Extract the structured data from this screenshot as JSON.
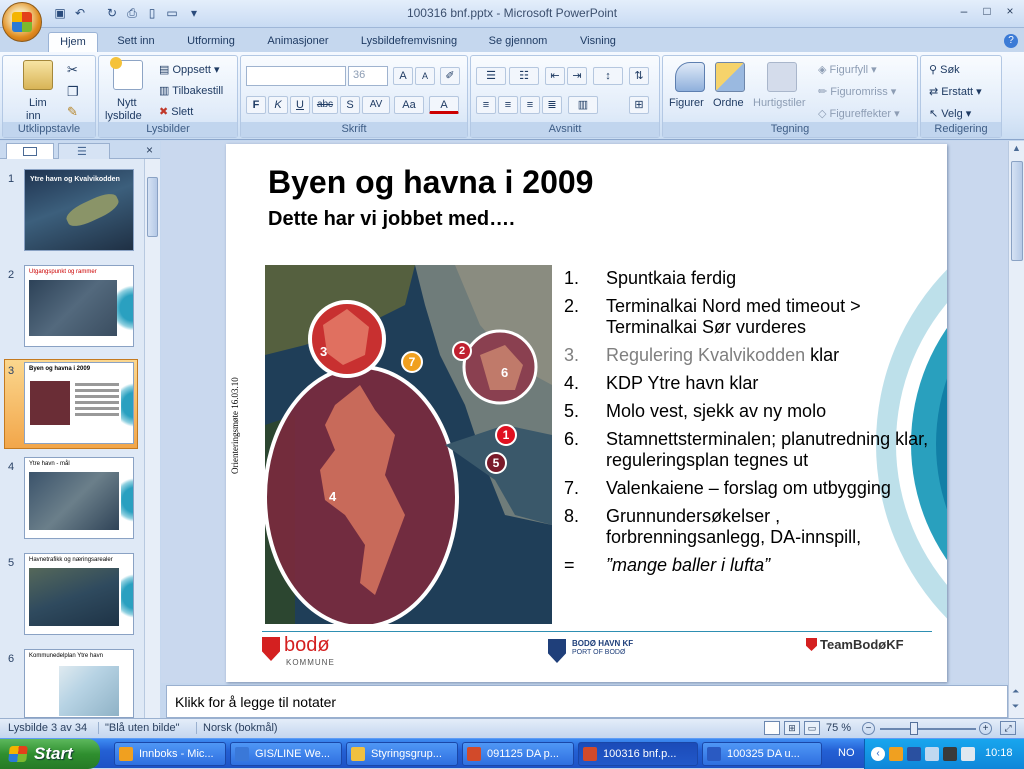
{
  "window": {
    "title": "100316 bnf.pptx - Microsoft PowerPoint",
    "controls": [
      "–",
      "□",
      "×"
    ]
  },
  "ribbon": {
    "tabs": [
      "Hjem",
      "Sett inn",
      "Utforming",
      "Animasjoner",
      "Lysbildefremvisning",
      "Se gjennom",
      "Visning"
    ],
    "groups": {
      "clipboard": {
        "label": "Utklippstavle",
        "paste_label_1": "Lim",
        "paste_label_2": "inn"
      },
      "slides": {
        "label": "Lysbilder",
        "new_1": "Nytt",
        "new_2": "lysbilde",
        "layout": "Oppsett",
        "reset": "Tilbakestill",
        "delete": "Slett"
      },
      "font": {
        "label": "Skrift",
        "size": "36",
        "bold": "F",
        "italic": "K",
        "underline": "U",
        "strike": "abc",
        "shadow": "S",
        "spacing": "AV",
        "case": "Aa",
        "grow": "A",
        "shrink": "A"
      },
      "paragraph": {
        "label": "Avsnitt"
      },
      "drawing": {
        "label": "Tegning",
        "shapes": "Figurer",
        "arrange": "Ordne",
        "quickstyles": "Hurtigstiler",
        "fill": "Figurfyll",
        "outline": "Figuromriss",
        "effects": "Figureffekter"
      },
      "editing": {
        "label": "Redigering",
        "find": "Søk",
        "replace": "Erstatt",
        "select": "Velg"
      }
    }
  },
  "thumbnails": [
    {
      "num": "1",
      "title": "Ytre havn og Kvalvikodden"
    },
    {
      "num": "2",
      "title": "Utgangspunkt og rammer"
    },
    {
      "num": "3",
      "title": "Byen og havna i 2009"
    },
    {
      "num": "4",
      "title": "Ytre havn - mål"
    },
    {
      "num": "5",
      "title": "Havnetrafikk og næringsarealer"
    },
    {
      "num": "6",
      "title": "Kommunedelplan Ytre havn"
    }
  ],
  "slide": {
    "title": "Byen og havna i 2009",
    "subtitle": "Dette har vi jobbet med….",
    "side_text": "Orienteringsmøte 16.03.10",
    "list": [
      {
        "n": "1.",
        "text": "Spuntkaia  ferdig",
        "color": "#000000"
      },
      {
        "n": "2.",
        "text": "Terminalkai Nord med timeout > Terminalkai Sør vurderes",
        "color": "#000000"
      },
      {
        "n": "3.",
        "text": "Regulering Kvalvikodden",
        "extra": " klar",
        "color": "#7f7f7f"
      },
      {
        "n": "4.",
        "text": "KDP Ytre havn klar",
        "color": "#000000"
      },
      {
        "n": "5.",
        "text": "Molo vest, sjekk av ny molo",
        "color": "#000000"
      },
      {
        "n": "6.",
        "text": "Stamnettsterminalen; planutredning klar, reguleringsplan tegnes ut",
        "color": "#000000"
      },
      {
        "n": "7.",
        "text": "Valenkaiene – forslag om utbygging",
        "color": "#000000"
      },
      {
        "n": "8.",
        "text": "Grunnundersøkelser , forbrenningsanlegg, DA-innspill,",
        "color": "#000000"
      },
      {
        "n": "=",
        "text": "”mange baller i lufta”",
        "color": "#000000",
        "italic": true
      }
    ],
    "map_markers": [
      "1",
      "2",
      "3",
      "4",
      "5",
      "6",
      "7"
    ],
    "logos": {
      "bodo": "bodø",
      "bodo_sub": "KOMMUNE",
      "havn": "BODØ HAVN KF",
      "havn_sub": "PORT OF BODØ",
      "team": "TeamBodøKF"
    }
  },
  "notes": {
    "placeholder": "Klikk for å legge til notater"
  },
  "status": {
    "slide": "Lysbilde 3 av 34",
    "theme": "\"Blå uten bilde\"",
    "language": "Norsk (bokmål)",
    "zoom": "75 %"
  },
  "taskbar": {
    "start": "Start",
    "tasks": [
      {
        "label": "Innboks - Mic...",
        "color": "#f0a020"
      },
      {
        "label": "GIS/LINE We...",
        "color": "#3a78d8"
      },
      {
        "label": "Styringsgrup...",
        "color": "#f0c040"
      },
      {
        "label": "091125 DA p...",
        "color": "#d24a2a"
      },
      {
        "label": "100316 bnf.p...",
        "color": "#d24a2a"
      },
      {
        "label": "100325 DA u...",
        "color": "#2a5ac2"
      }
    ],
    "lang": "NO",
    "clock": "10:18"
  }
}
